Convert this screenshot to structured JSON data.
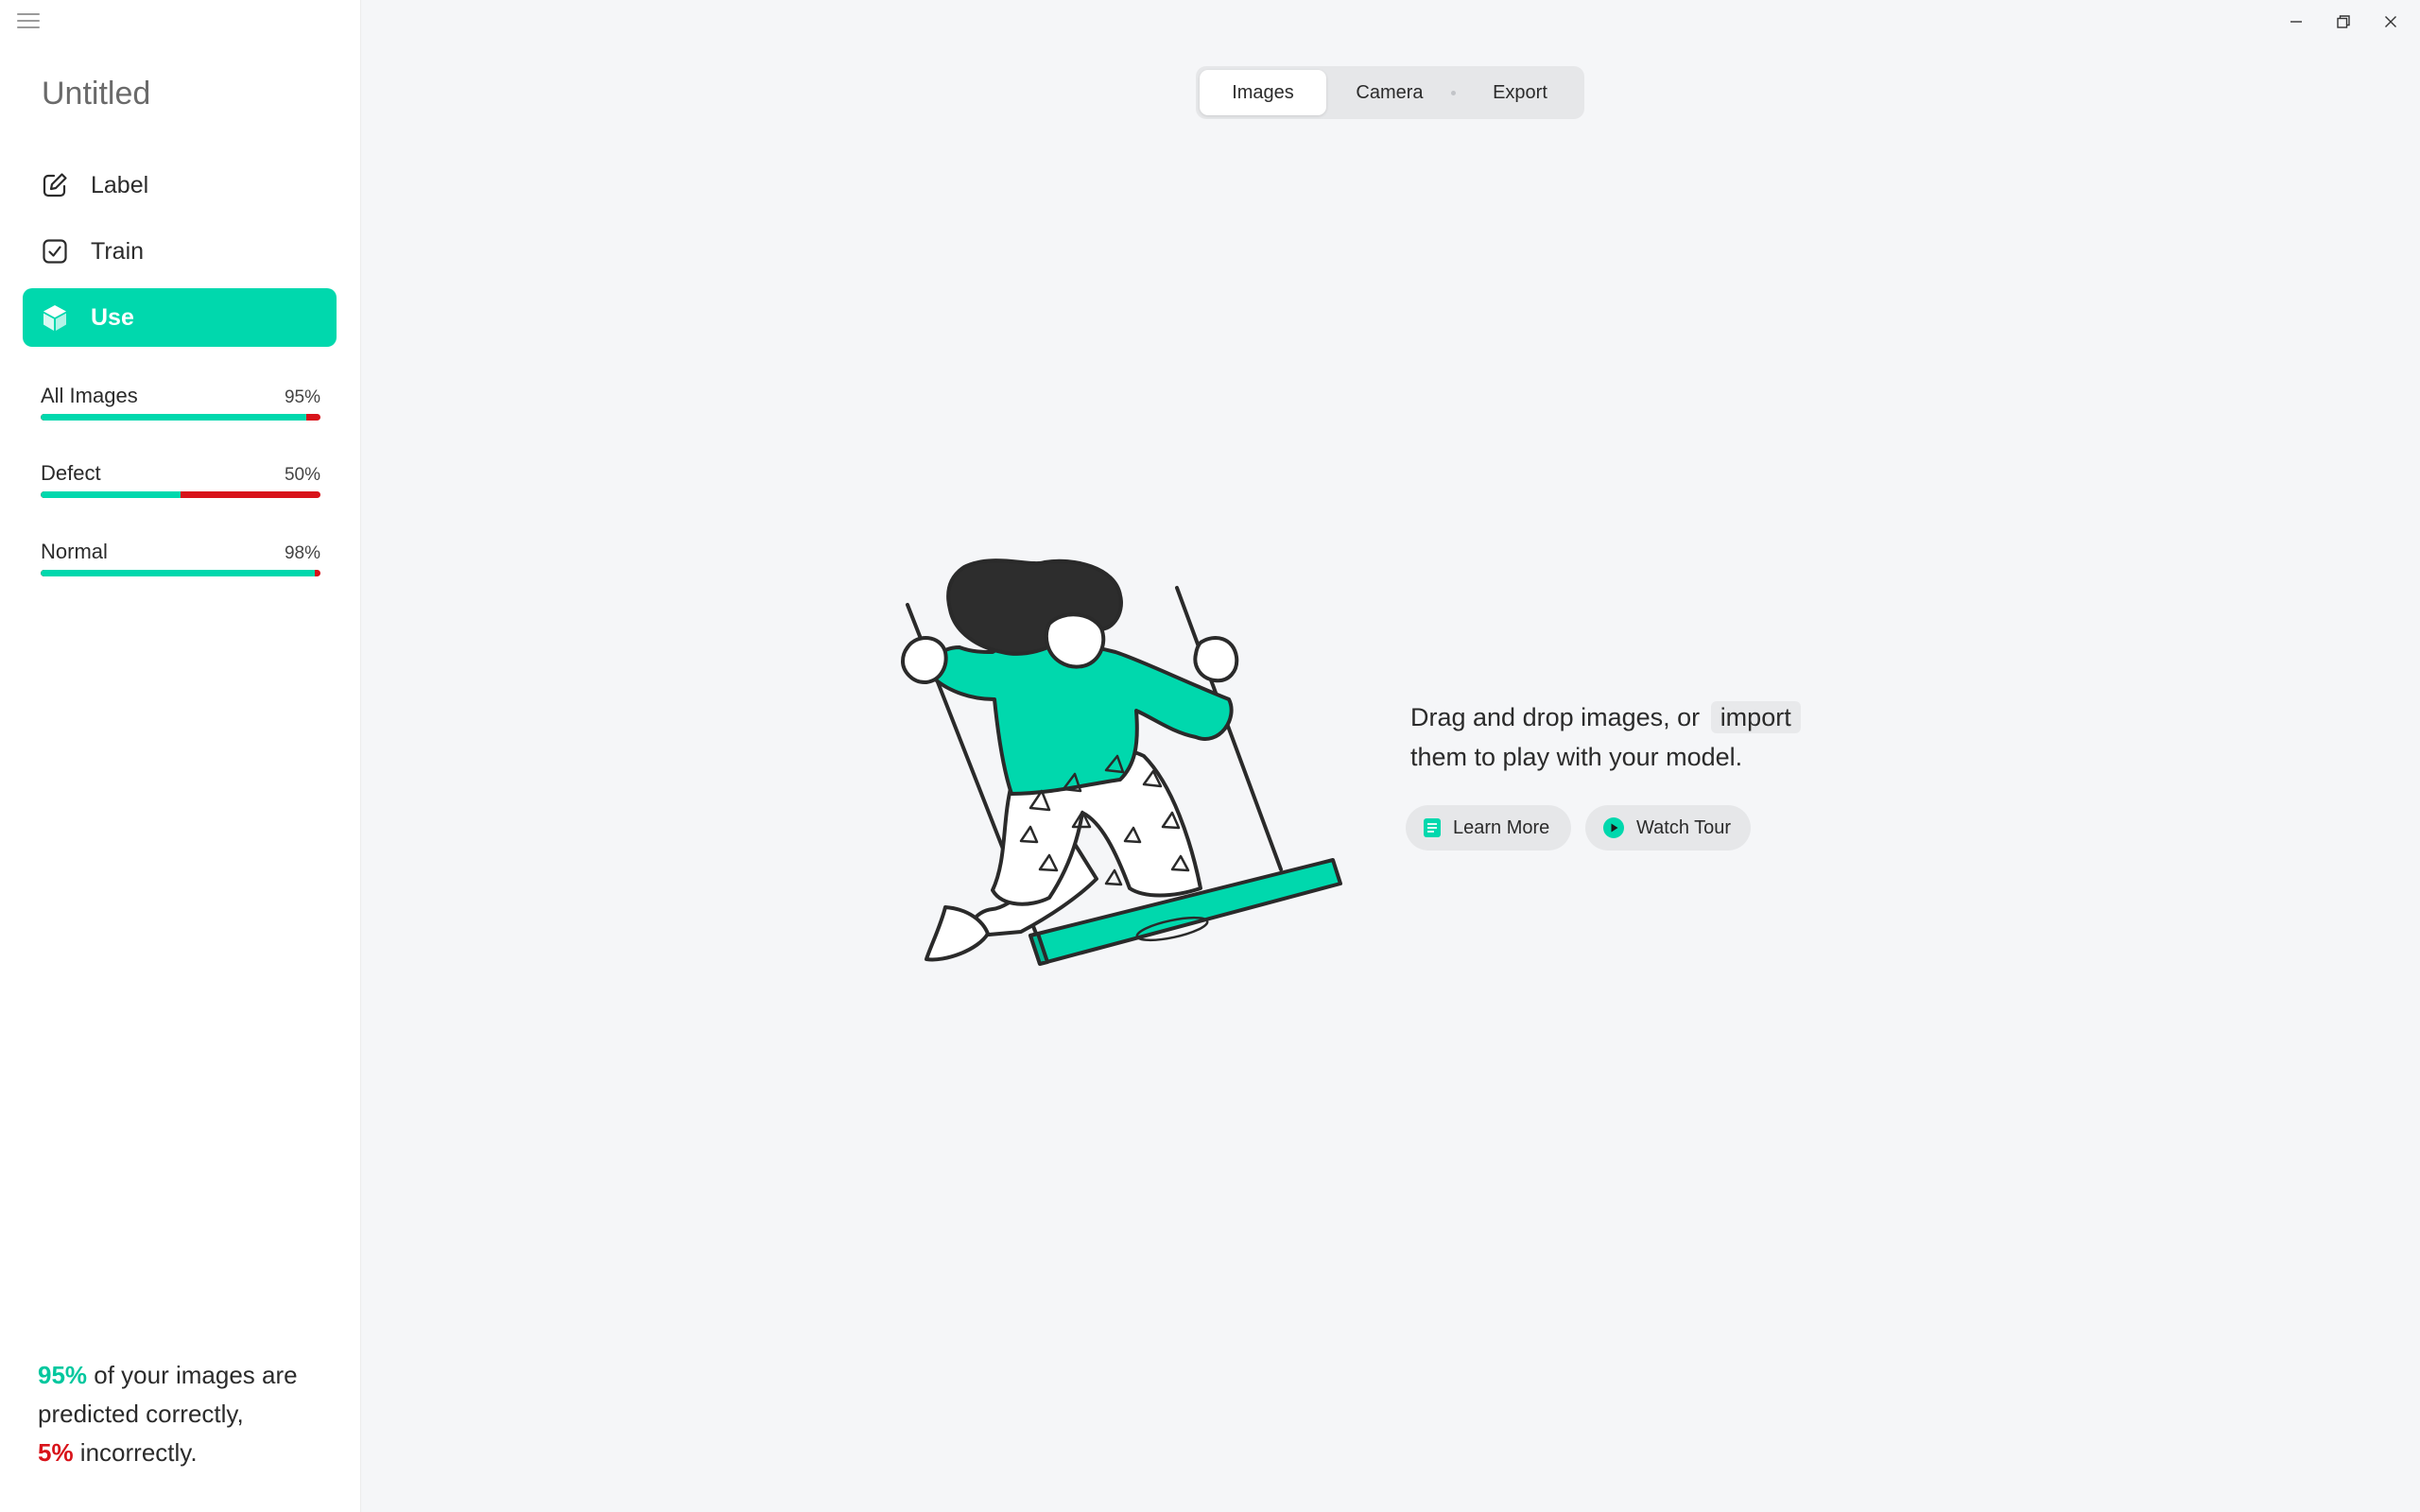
{
  "app": {
    "title": "Untitled"
  },
  "sidebar": {
    "nav": [
      {
        "label": "Label",
        "icon": "pencil-square-icon"
      },
      {
        "label": "Train",
        "icon": "checkbox-icon"
      },
      {
        "label": "Use",
        "icon": "cube-icon",
        "active": true
      }
    ],
    "stats": [
      {
        "label": "All Images",
        "percent_text": "95%",
        "correct_fraction": 0.95
      },
      {
        "label": "Defect",
        "percent_text": "50%",
        "correct_fraction": 0.5
      },
      {
        "label": "Normal",
        "percent_text": "98%",
        "correct_fraction": 0.98
      }
    ],
    "summary": {
      "correct_pct": "95%",
      "text1": " of your images are predicted correctly,",
      "incorrect_pct": "5%",
      "text2": " incorrectly."
    }
  },
  "tabs": [
    {
      "label": "Images",
      "selected": true
    },
    {
      "label": "Camera"
    },
    {
      "label": "Export"
    }
  ],
  "main": {
    "instructions_line1": "Drag and drop images, or",
    "import_link": "import",
    "instructions_line2": "them to play with your model.",
    "learn_more": "Learn More",
    "watch_tour": "Watch Tour"
  },
  "colors": {
    "accent": "#00d8ad",
    "error": "#d8131a",
    "background": "#f5f6f8"
  }
}
